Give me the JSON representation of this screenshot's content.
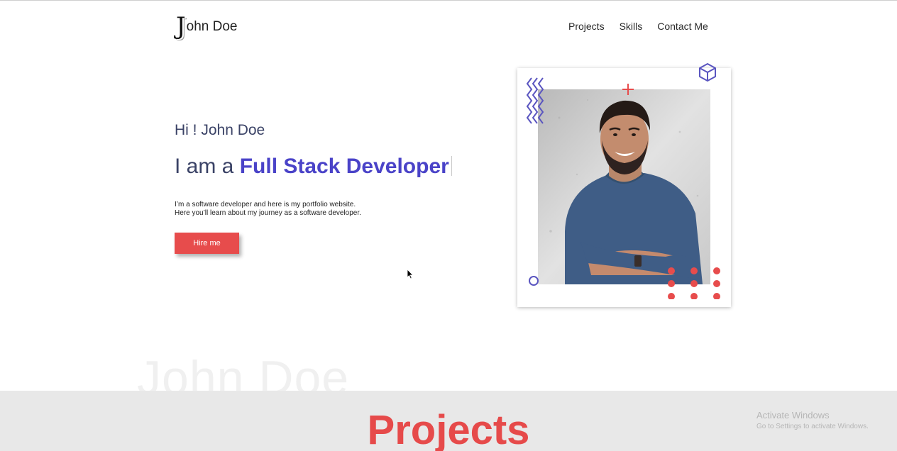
{
  "brand": {
    "logo_letter": "J",
    "name": "ohn Doe"
  },
  "nav": {
    "items": [
      {
        "label": "Projects"
      },
      {
        "label": "Skills"
      },
      {
        "label": "Contact Me"
      }
    ]
  },
  "hero": {
    "greeting": "Hi ! John Doe",
    "headline_prefix": "I am a ",
    "headline_role": "Full Stack Developer",
    "description_line1": "I’m a software developer and here is my portfolio website.",
    "description_line2": "Here you’ll learn about my journey as a software developer.",
    "cta_label": "Hire me"
  },
  "watermark": "John Doe",
  "section": {
    "title": "Projects"
  },
  "os_overlay": {
    "line1": "Activate Windows",
    "line2": "Go to Settings to activate Windows."
  },
  "colors": {
    "accent_red": "#e74c4c",
    "accent_purple": "#4a43c8",
    "text_dark": "#3a4266",
    "band_bg": "#e8e8e8"
  }
}
